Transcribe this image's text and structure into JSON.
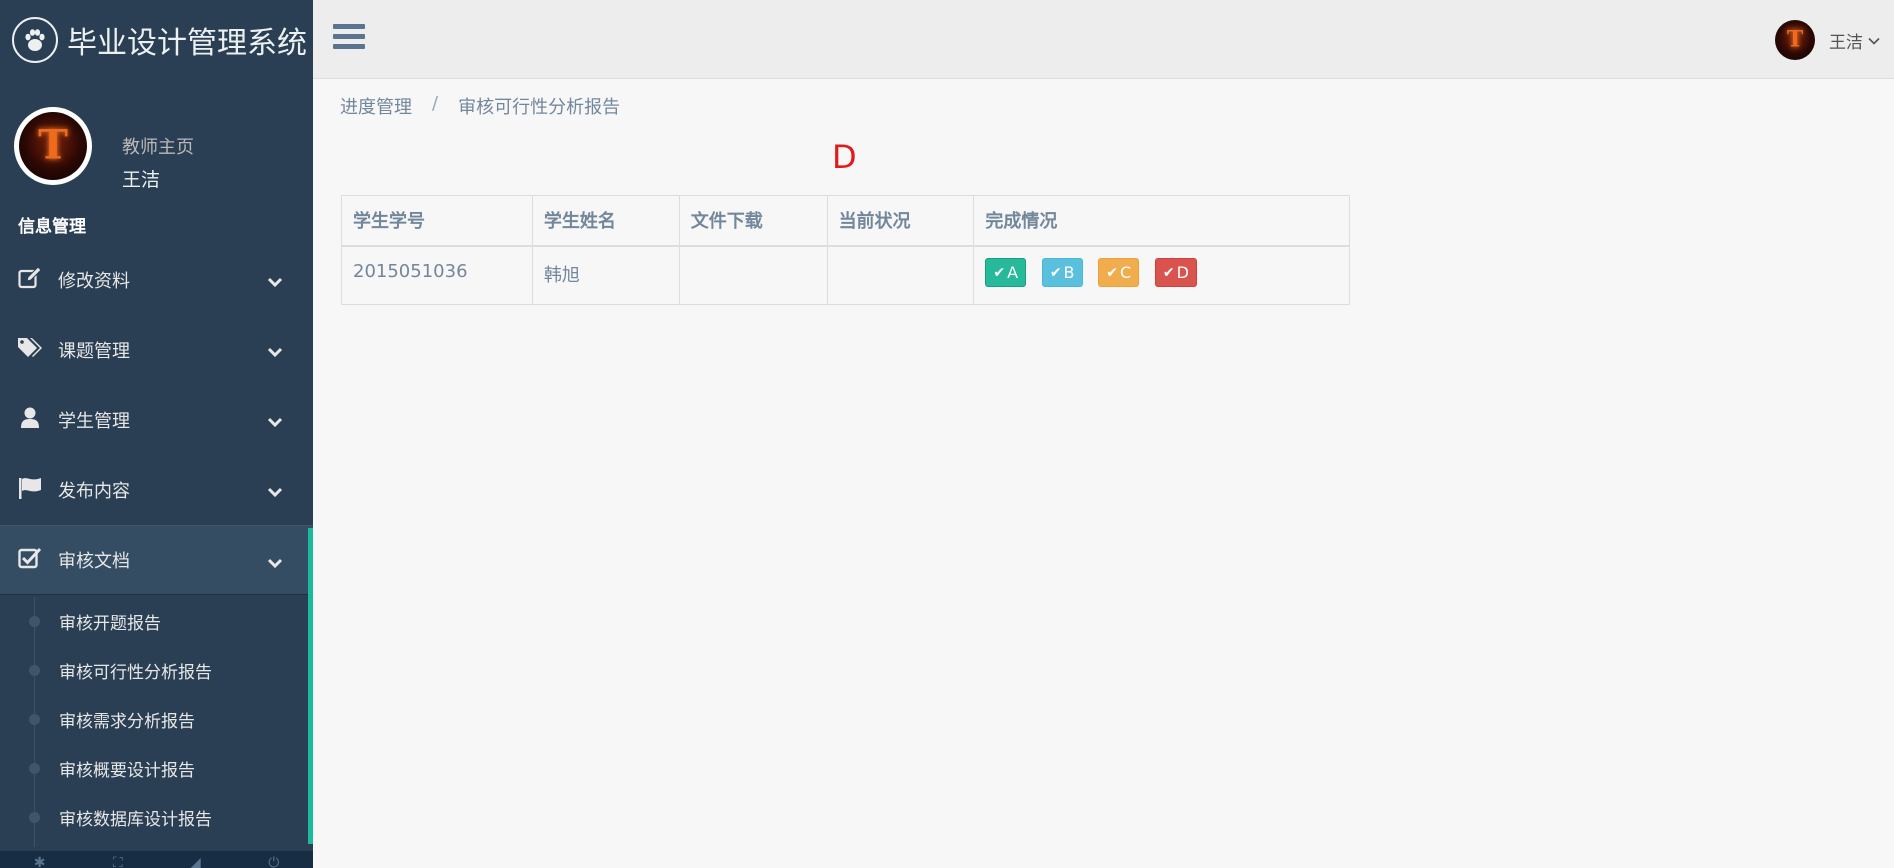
{
  "brand": {
    "title": "毕业设计管理系统",
    "logo_icon": "paw-icon"
  },
  "profile": {
    "welcome": "教师主页",
    "name": "王洁"
  },
  "sidebar": {
    "section_title": "信息管理",
    "items": [
      {
        "label": "修改资料",
        "icon": "edit-icon"
      },
      {
        "label": "课题管理",
        "icon": "tags-icon"
      },
      {
        "label": "学生管理",
        "icon": "user-icon"
      },
      {
        "label": "发布内容",
        "icon": "flag-icon"
      },
      {
        "label": "审核文档",
        "icon": "check-square-icon"
      }
    ],
    "submenu": [
      {
        "label": "审核开题报告"
      },
      {
        "label": "审核可行性分析报告"
      },
      {
        "label": "审核需求分析报告"
      },
      {
        "label": "审核概要设计报告"
      },
      {
        "label": "审核数据库设计报告"
      }
    ]
  },
  "topnav": {
    "user_name": "王洁"
  },
  "breadcrumb": {
    "parent": "进度管理",
    "separator": "/",
    "current": "审核可行性分析报告"
  },
  "grade_display": "D",
  "table": {
    "headers": [
      "学生学号",
      "学生姓名",
      "文件下载",
      "当前状况",
      "完成情况"
    ],
    "rows": [
      {
        "student_id": "2015051036",
        "student_name": "韩旭",
        "file": "",
        "status": ""
      }
    ],
    "grade_buttons": [
      "A",
      "B",
      "C",
      "D"
    ]
  },
  "colors": {
    "sidebar_bg": "#2a3f54",
    "accent": "#1abb9c",
    "grade_text": "#e21a1a",
    "btn_a": "#26b99a",
    "btn_b": "#5bc0de",
    "btn_c": "#f0ad4e",
    "btn_d": "#d9534f"
  }
}
